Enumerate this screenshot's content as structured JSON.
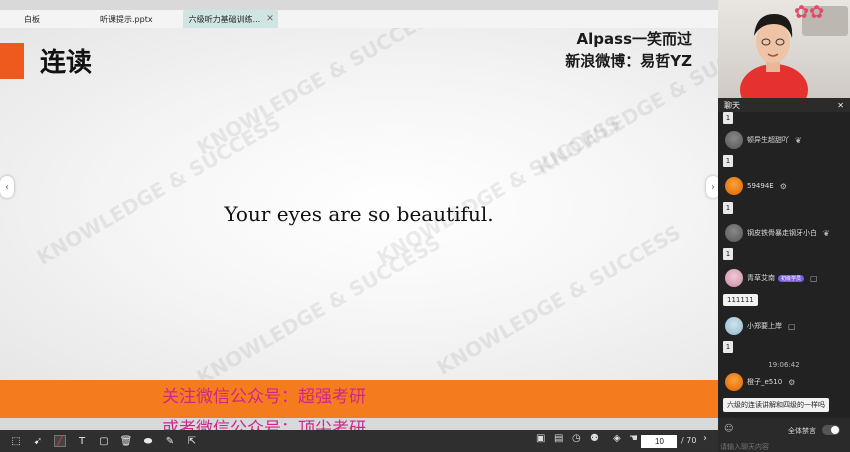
{
  "tabs": [
    {
      "label": "白板"
    },
    {
      "label": "听课提示.pptx"
    },
    {
      "label": "六级听力基础训练..."
    }
  ],
  "slide": {
    "heading": "连读",
    "brand_line1": "Alpass一笑而过",
    "brand_line2": "新浪微博：易哲YZ",
    "sentence": "Your eyes are so beautiful.",
    "watermark": "KNOWLEDGE & SUCCESS"
  },
  "promo": {
    "line1": "关注微信公众号：超强考研",
    "line2": "或者微信公众号：顶尖考研"
  },
  "toolbar": {
    "current_page": "10",
    "total_pages": "/ 70"
  },
  "chat": {
    "title": "聊天",
    "one": "1",
    "users": [
      {
        "name": "顿异生超甜吖"
      },
      {
        "name": "59494E"
      },
      {
        "name": "钢皮铁骨暴走钢牙小白"
      },
      {
        "name": "青草艾南"
      },
      {
        "name": "小郑要上岸"
      },
      {
        "name": "橙子_e510"
      }
    ],
    "level_badge": "初级学员",
    "msg_111111": "111111",
    "timestamp": "19:06:42",
    "last_message": "六级的连读讲解和四级的一样吗",
    "mute_label": "全体禁言",
    "input_placeholder": "请输入聊天内容"
  },
  "colors": {
    "accent_orange": "#ee5a1e",
    "banner_orange": "#f47c1f",
    "promo_magenta": "#d0268a",
    "tab_active": "#cfe5e4"
  }
}
